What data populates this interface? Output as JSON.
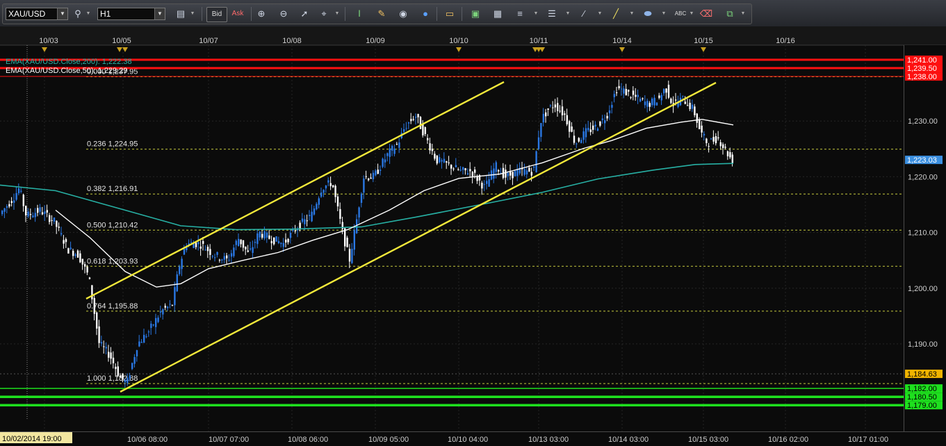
{
  "toolbar": {
    "symbol": "XAU/USD",
    "timeframe": "H1",
    "bid_label": "Bid",
    "ask_label": "Ask",
    "text_tool_label": "ABC",
    "icons": [
      "symbol-search-icon",
      "chart-type-icon",
      "crosshair-icon",
      "zoom-in-icon",
      "zoom-out-icon",
      "cursor-icon",
      "select-icon",
      "indicator-icon",
      "edit-icon",
      "eye-icon",
      "globe-icon",
      "ruler-icon",
      "news-icon",
      "window-icon",
      "fibonacci-icon",
      "lines-icon",
      "pen-icon",
      "trendline-icon",
      "shapes-icon",
      "text-icon",
      "eraser-icon",
      "layers-icon"
    ]
  },
  "indicators": {
    "ema200_label": "EMA(XAU/USD.Close,200): 1,222.38",
    "ema50_label": "EMA(XAU/USD.Close,50): 1,229.29",
    "ema200_color": "#27b0a4",
    "ema50_color": "#ffffff"
  },
  "top_dates": [
    "10/03",
    "10/05",
    "10/07",
    "10/08",
    "10/09",
    "10/10",
    "10/11",
    "10/14",
    "10/15",
    "10/16"
  ],
  "bottom_dates": [
    "10/02/2014 19:00",
    "10/06 08:00",
    "10/07 07:00",
    "10/08 06:00",
    "10/09 05:00",
    "10/10 04:00",
    "10/13 03:00",
    "10/14 03:00",
    "10/15 03:00",
    "10/16 02:00",
    "10/17 01:00"
  ],
  "price_ticks": [
    "1,230.00",
    "1,220.00",
    "1,210.00",
    "1,200.00",
    "1,190.00"
  ],
  "fib_levels": [
    {
      "ratio": "0.000",
      "price": "1,237.95",
      "value": 1237.95
    },
    {
      "ratio": "0.236",
      "price": "1,224.95",
      "value": 1224.95
    },
    {
      "ratio": "0.382",
      "price": "1,216.91",
      "value": 1216.91
    },
    {
      "ratio": "0.500",
      "price": "1,210.42",
      "value": 1210.42
    },
    {
      "ratio": "0.618",
      "price": "1,203.93",
      "value": 1203.93
    },
    {
      "ratio": "0.764",
      "price": "1,195.88",
      "value": 1195.88
    },
    {
      "ratio": "1.000",
      "price": "1,182.88",
      "value": 1182.88
    }
  ],
  "resistance": [
    {
      "label": "1,241.00",
      "value": 1241.0
    },
    {
      "label": "1,239.50",
      "value": 1239.5
    },
    {
      "label": "1,238.00",
      "value": 1238.0
    }
  ],
  "support": [
    {
      "label": "1,182.00",
      "value": 1182.0
    },
    {
      "label": "1,180.50",
      "value": 1180.5
    },
    {
      "label": "1,179.00",
      "value": 1179.0
    }
  ],
  "current_price": {
    "label": "1,223.03",
    "value": 1223.03
  },
  "marker_price": {
    "label": "1,184.63",
    "value": 1184.63
  },
  "colors": {
    "background": "#0b0b0b",
    "grid": "#262626",
    "bull": "#2a78e4",
    "bear": "#ffffff",
    "fib": "#c7cb3e",
    "channel": "#f2e83a",
    "resistance": "#ff1010",
    "support": "#1ee01e",
    "current_price_bg": "#3b8fe0",
    "marker_price_bg": "#f0b400"
  },
  "chart_data": {
    "type": "candlestick",
    "symbol": "XAU/USD",
    "timeframe": "H1",
    "y_range": [
      1178,
      1242.5
    ],
    "ema200": [
      [
        0,
        1218.5
      ],
      [
        80,
        1217.5
      ],
      [
        180,
        1214
      ],
      [
        260,
        1211.2
      ],
      [
        340,
        1210.5
      ],
      [
        420,
        1210.6
      ],
      [
        520,
        1211
      ],
      [
        600,
        1212.8
      ],
      [
        700,
        1215.2
      ],
      [
        780,
        1217.2
      ],
      [
        860,
        1219.6
      ],
      [
        940,
        1221.2
      ],
      [
        1000,
        1222.2
      ],
      [
        1055,
        1222.4
      ]
    ],
    "ema50": [
      [
        80,
        1214
      ],
      [
        130,
        1209
      ],
      [
        180,
        1203
      ],
      [
        225,
        1200.2
      ],
      [
        260,
        1200.8
      ],
      [
        300,
        1203.5
      ],
      [
        350,
        1205
      ],
      [
        400,
        1206.4
      ],
      [
        450,
        1208.6
      ],
      [
        500,
        1210.5
      ],
      [
        560,
        1214
      ],
      [
        610,
        1217.5
      ],
      [
        660,
        1219.7
      ],
      [
        720,
        1220.5
      ],
      [
        780,
        1222.5
      ],
      [
        840,
        1225.1
      ],
      [
        880,
        1226.5
      ],
      [
        930,
        1228.7
      ],
      [
        980,
        1229.8
      ],
      [
        1010,
        1230.3
      ],
      [
        1055,
        1229.3
      ]
    ],
    "ohlc_pivots": [
      [
        0,
        1213
      ],
      [
        20,
        1216
      ],
      [
        30,
        1218
      ],
      [
        40,
        1213
      ],
      [
        60,
        1214
      ],
      [
        80,
        1212
      ],
      [
        100,
        1207
      ],
      [
        115,
        1206
      ],
      [
        130,
        1202
      ],
      [
        145,
        1190
      ],
      [
        160,
        1188
      ],
      [
        175,
        1184
      ],
      [
        185,
        1183
      ],
      [
        200,
        1190
      ],
      [
        215,
        1192
      ],
      [
        235,
        1196
      ],
      [
        250,
        1197
      ],
      [
        260,
        1204
      ],
      [
        270,
        1208
      ],
      [
        290,
        1208
      ],
      [
        310,
        1206
      ],
      [
        330,
        1205
      ],
      [
        345,
        1209
      ],
      [
        360,
        1206
      ],
      [
        375,
        1210
      ],
      [
        390,
        1209
      ],
      [
        410,
        1208
      ],
      [
        430,
        1211
      ],
      [
        450,
        1213
      ],
      [
        465,
        1218
      ],
      [
        480,
        1219
      ],
      [
        495,
        1210
      ],
      [
        505,
        1205
      ],
      [
        515,
        1212
      ],
      [
        525,
        1220
      ],
      [
        540,
        1220
      ],
      [
        560,
        1224
      ],
      [
        575,
        1226
      ],
      [
        585,
        1229
      ],
      [
        600,
        1231
      ],
      [
        615,
        1227
      ],
      [
        630,
        1223
      ],
      [
        650,
        1222
      ],
      [
        665,
        1221
      ],
      [
        680,
        1221
      ],
      [
        700,
        1218
      ],
      [
        715,
        1222
      ],
      [
        730,
        1220
      ],
      [
        750,
        1221
      ],
      [
        770,
        1221
      ],
      [
        780,
        1230
      ],
      [
        790,
        1232
      ],
      [
        800,
        1233
      ],
      [
        815,
        1231
      ],
      [
        830,
        1226
      ],
      [
        845,
        1228
      ],
      [
        860,
        1229
      ],
      [
        875,
        1231
      ],
      [
        890,
        1236
      ],
      [
        905,
        1235
      ],
      [
        920,
        1234
      ],
      [
        935,
        1233
      ],
      [
        950,
        1234
      ],
      [
        960,
        1236
      ],
      [
        970,
        1233
      ],
      [
        985,
        1234
      ],
      [
        1000,
        1232
      ],
      [
        1010,
        1228
      ],
      [
        1020,
        1226
      ],
      [
        1035,
        1227
      ],
      [
        1045,
        1225
      ],
      [
        1055,
        1223
      ]
    ]
  }
}
